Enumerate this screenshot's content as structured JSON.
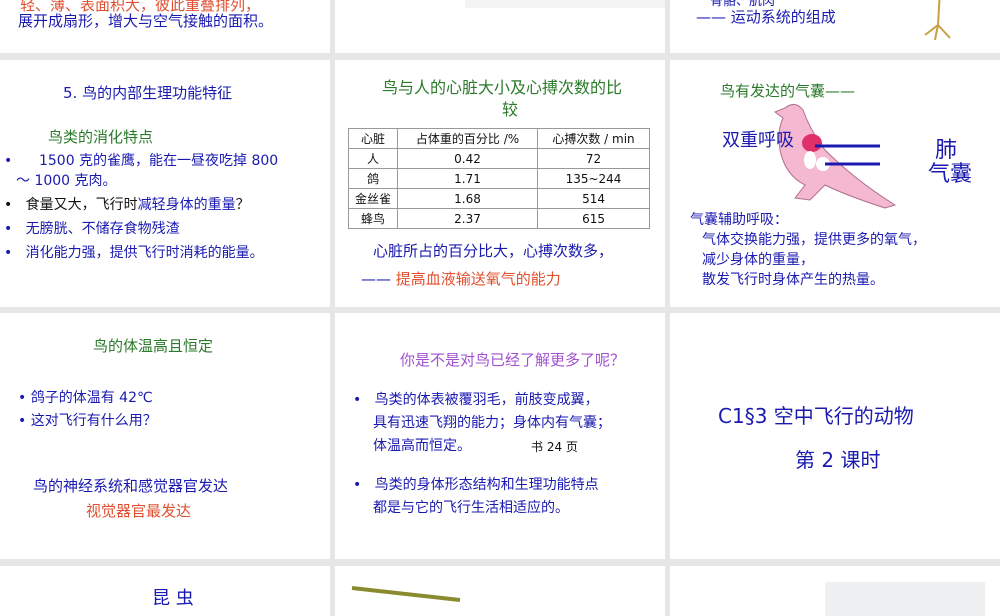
{
  "slides": [
    {
      "line1": "轻、薄、表面积大，彼此重叠排列，",
      "line2": "展开成扇形，增大与空气接触的面积。"
    },
    {},
    {
      "line1": "骨骼、肌肉",
      "line2": "—— 运动系统的组成"
    },
    {
      "title": "5. 鸟的内部生理功能特征",
      "subtitle": "鸟类的消化特点",
      "bullets": [
        "1500 克的雀鹰，能在一昼夜吃掉 800",
        "～ 1000 克肉。",
        "食量又大，飞行时",
        "减轻身体的重量",
        "？",
        "无膀胱、不储存食物残渣",
        "消化能力强，提供飞行时消耗的能量。"
      ]
    },
    {
      "title_line1": "鸟与人的心脏大小及心搏次数的比",
      "title_line2": "较",
      "table": {
        "headers": [
          "心脏",
          "占体重的百分比 /%",
          "心搏次数 / min"
        ],
        "rows": [
          [
            "人",
            "0.42",
            "72"
          ],
          [
            "鸽",
            "1.71",
            "135~244"
          ],
          [
            "金丝雀",
            "1.68",
            "514"
          ],
          [
            "蜂鸟",
            "2.37",
            "615"
          ]
        ]
      },
      "note1": "心脏所占的百分比大，心搏次数多，",
      "note2_dash": "——",
      "note2": "提高血液输送氧气的能力"
    },
    {
      "title": "鸟有发达的气囊——",
      "label_breath": "双重呼吸",
      "label_lung": "肺",
      "label_sac": "气囊",
      "sub": "气囊辅助呼吸：",
      "lines": [
        "气体交换能力强，提供更多的氧气，",
        "减少身体的重量，",
        "散发飞行时身体产生的热量。"
      ]
    },
    {
      "title": "鸟的体温高且恒定",
      "bullets": [
        "鸽子的体温有 42℃",
        "这对飞行有什么用？"
      ],
      "line1": "鸟的神经系统和感觉器官发达",
      "line2": "视觉器官最发达"
    },
    {
      "title": "你是不是对鸟已经了解更多了呢？",
      "b1": [
        "鸟类的体表被覆羽毛，前肢变成翼，",
        "具有迅速飞翔的能力；身体内有气囊；",
        "体温高而恒定。"
      ],
      "ref": "书 24 页",
      "b2": [
        "鸟类的身体形态结构和生理功能特点",
        "都是与它的飞行生活相适应的。"
      ]
    },
    {
      "title": "C1§3  空中飞行的动物",
      "subtitle": "第 2 课时"
    },
    {
      "title": "昆 虫"
    },
    {},
    {}
  ]
}
